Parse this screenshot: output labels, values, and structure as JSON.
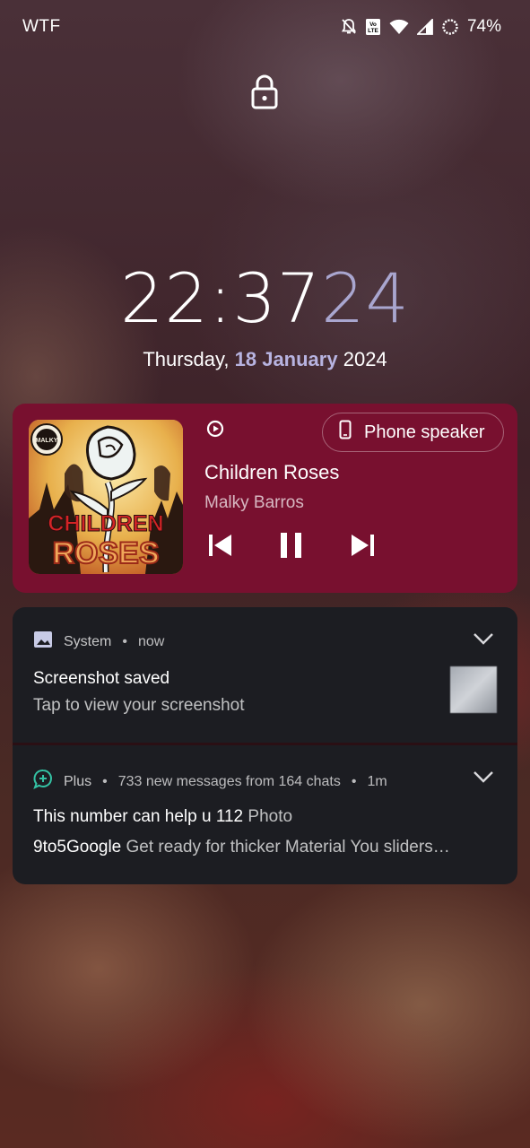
{
  "status_bar": {
    "carrier": "WTF",
    "battery": "74%",
    "icons": [
      "bell-off-icon",
      "volte-icon",
      "wifi-icon",
      "signal-icon",
      "battery-saver-ring-icon"
    ]
  },
  "lockscreen": {
    "lock_icon": "lock-icon",
    "clock_hm": "22:37",
    "clock_sec": "24",
    "date_weekday": "Thursday,",
    "date_highlight": "18 January",
    "date_year": "2024"
  },
  "media": {
    "output_button": "Phone speaker",
    "title": "Children Roses",
    "artist": "Malky Barros",
    "art_text_top": "CHILDREN",
    "art_text_bottom": "ROSES",
    "art_logo": "MALKY",
    "colors": {
      "card": "#78102f"
    }
  },
  "notifications": [
    {
      "app": "System",
      "time": "now",
      "title": "Screenshot saved",
      "text": "Tap to view your screenshot"
    },
    {
      "app": "Plus",
      "summary": "733 new messages from 164 chats",
      "time": "1m",
      "line1_sender": "This number can help u 112",
      "line1_text": "Photo",
      "line2_sender": "9to5Google",
      "line2_text": "Get ready for thicker Material You sliders…"
    }
  ]
}
